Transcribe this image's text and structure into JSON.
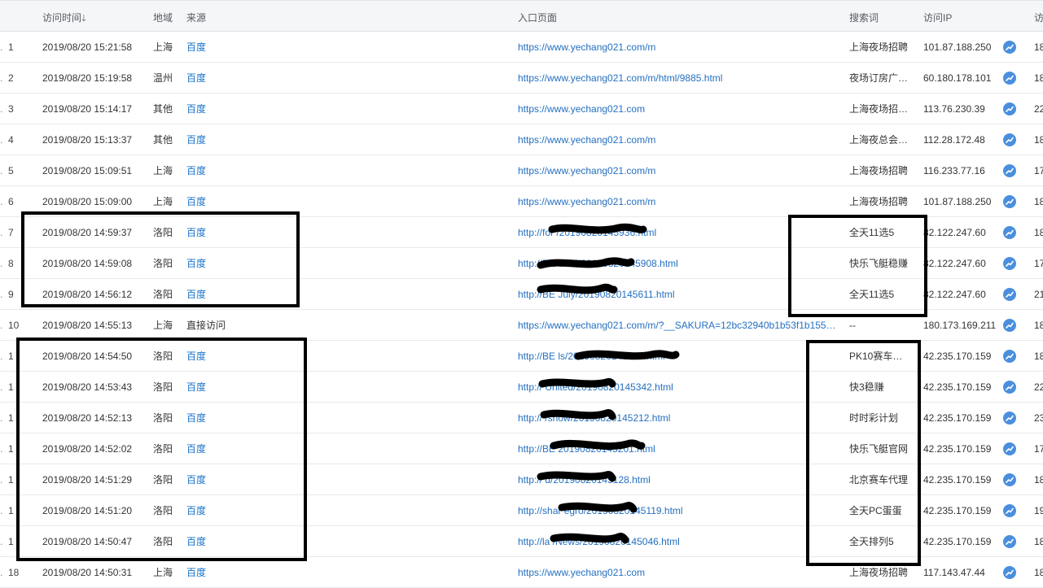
{
  "columns": {
    "visit_time": "访问时间",
    "sort_icon": "arrow-down",
    "region": "地域",
    "source": "来源",
    "entry_page": "入口页面",
    "keyword": "搜索词",
    "ip": "访问IP",
    "last": "访"
  },
  "rows": [
    {
      "num": "1",
      "time": "2019/08/20 15:21:58",
      "region": "上海",
      "source": "百度",
      "page": "https://www.yechang021.com/m",
      "keyword": "上海夜场招聘",
      "ip": "101.87.188.250",
      "extra": "18"
    },
    {
      "num": "2",
      "time": "2019/08/20 15:19:58",
      "region": "温州",
      "source": "百度",
      "page": "https://www.yechang021.com/m/html/9885.html",
      "keyword": "夜场订房广…",
      "ip": "60.180.178.101",
      "extra": "18"
    },
    {
      "num": "3",
      "time": "2019/08/20 15:14:17",
      "region": "其他",
      "source": "百度",
      "page": "https://www.yechang021.com",
      "keyword": "上海夜场招…",
      "ip": "113.76.230.39",
      "extra": "22"
    },
    {
      "num": "4",
      "time": "2019/08/20 15:13:37",
      "region": "其他",
      "source": "百度",
      "page": "https://www.yechang021.com/m",
      "keyword": "上海夜总会…",
      "ip": "112.28.172.48",
      "extra": "18"
    },
    {
      "num": "5",
      "time": "2019/08/20 15:09:51",
      "region": "上海",
      "source": "百度",
      "page": "https://www.yechang021.com/m",
      "keyword": "上海夜场招聘",
      "ip": "116.233.77.16",
      "extra": "17"
    },
    {
      "num": "6",
      "time": "2019/08/20 15:09:00",
      "region": "上海",
      "source": "百度",
      "page": "https://www.yechang021.com/m",
      "keyword": "上海夜场招聘",
      "ip": "101.87.188.250",
      "extra": "18"
    },
    {
      "num": "7",
      "time": "2019/08/20 14:59:37",
      "region": "洛阳",
      "source": "百度",
      "page": "http://for                              /20190820145936.html",
      "keyword": "全天11选5",
      "ip": "82.122.247.60",
      "extra": "18"
    },
    {
      "num": "8",
      "time": "2019/08/20 14:59:08",
      "region": "洛阳",
      "source": "百度",
      "page": "http://BE                         uncil/20190820145908.html",
      "keyword": "快乐飞艇稳赚",
      "ip": "82.122.247.60",
      "extra": "17"
    },
    {
      "num": "9",
      "time": "2019/08/20 14:56:12",
      "region": "洛阳",
      "source": "百度",
      "page": "http://BE                        July/20190820145611.html",
      "keyword": "全天11选5",
      "ip": "82.122.247.60",
      "extra": "21"
    },
    {
      "num": "10",
      "time": "2019/08/20 14:55:13",
      "region": "上海",
      "source": "直接访问",
      "page": "https://www.yechang021.com/m/?__SAKURA=12bc32940b1b53f1b155…",
      "keyword": "--",
      "ip": "180.173.169.211",
      "extra": "18"
    },
    {
      "num": "1",
      "time": "2019/08/20 14:54:50",
      "region": "洛阳",
      "source": "百度",
      "page": "http://BE                          ls/20190820145449.html",
      "keyword": "PK10赛车…",
      "ip": "42.235.170.159",
      "extra": "18"
    },
    {
      "num": "1",
      "time": "2019/08/20 14:53:43",
      "region": "洛阳",
      "source": "百度",
      "page": "http://                          United/20190820145342.html",
      "keyword": "快3稳赚",
      "ip": "42.235.170.159",
      "extra": "22"
    },
    {
      "num": "1",
      "time": "2019/08/20 14:52:13",
      "region": "洛阳",
      "source": "百度",
      "page": "http://                        /show/20190820145212.html",
      "keyword": "时时彩计划",
      "ip": "42.235.170.159",
      "extra": "23"
    },
    {
      "num": "1",
      "time": "2019/08/20 14:52:02",
      "region": "洛阳",
      "source": "百度",
      "page": "http://BE                              20190820145201.html",
      "keyword": "快乐飞艇官网",
      "ip": "42.235.170.159",
      "extra": "17"
    },
    {
      "num": "1",
      "time": "2019/08/20 14:51:29",
      "region": "洛阳",
      "source": "百度",
      "page": "http://                       d/20190820145128.html",
      "keyword": "北京赛车代理",
      "ip": "42.235.170.159",
      "extra": "18"
    },
    {
      "num": "1",
      "time": "2019/08/20 14:51:20",
      "region": "洛阳",
      "source": "百度",
      "page": "http://shar                      egro/20190820145119.html",
      "keyword": "全天PC蛋蛋",
      "ip": "42.235.170.159",
      "extra": "19"
    },
    {
      "num": "1",
      "time": "2019/08/20 14:50:47",
      "region": "洛阳",
      "source": "百度",
      "page": "http://la                          /News/20190820145046.html",
      "keyword": "全天排列5",
      "ip": "42.235.170.159",
      "extra": "18"
    },
    {
      "num": "18",
      "time": "2019/08/20 14:50:31",
      "region": "上海",
      "source": "百度",
      "page": "https://www.yechang021.com",
      "keyword": "上海夜场招聘",
      "ip": "117.143.47.44",
      "extra": "18"
    }
  ],
  "icons": {
    "trend": "trend-chart-icon"
  },
  "colors": {
    "link": "#1a73c9",
    "trend": "#4a8fde",
    "header_bg": "#f5f6f8",
    "annotation": "#000000"
  }
}
